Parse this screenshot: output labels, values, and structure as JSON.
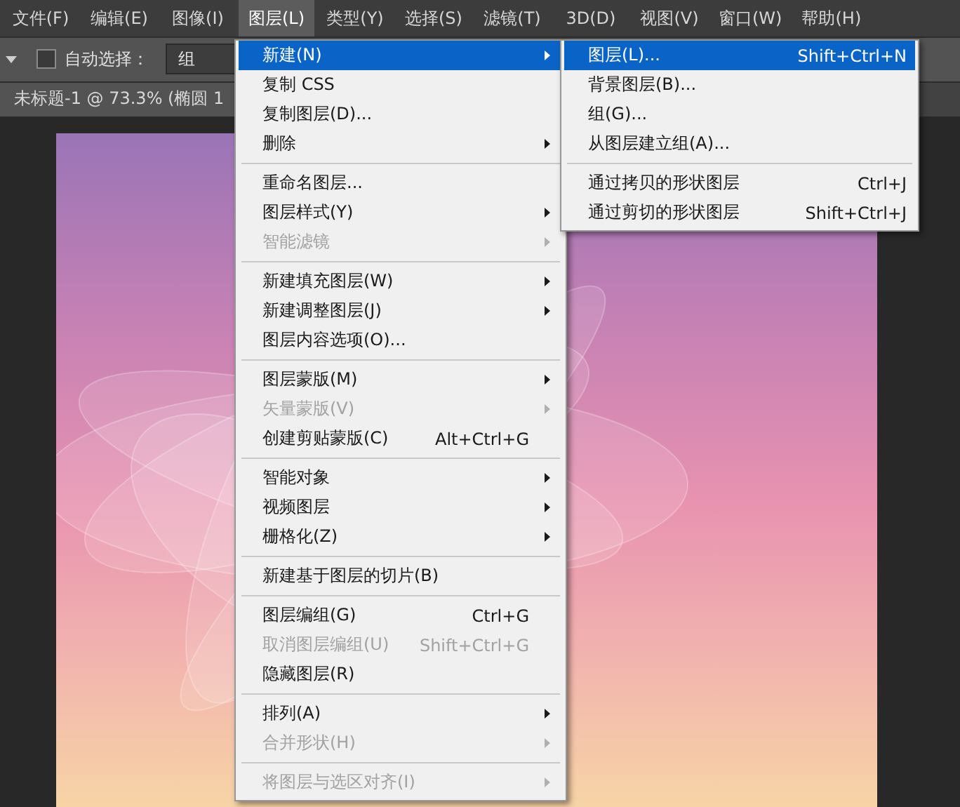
{
  "menubar": [
    {
      "label": "文件(F)",
      "selected": false
    },
    {
      "label": "编辑(E)",
      "selected": false
    },
    {
      "label": "图像(I)",
      "selected": false
    },
    {
      "label": "图层(L)",
      "selected": true
    },
    {
      "label": "类型(Y)",
      "selected": false
    },
    {
      "label": "选择(S)",
      "selected": false
    },
    {
      "label": "滤镜(T)",
      "selected": false
    },
    {
      "label": "3D(D)",
      "selected": false
    },
    {
      "label": "视图(V)",
      "selected": false
    },
    {
      "label": "窗口(W)",
      "selected": false
    },
    {
      "label": "帮助(H)",
      "selected": false
    }
  ],
  "toolbar": {
    "auto_select": {
      "label": "自动选择：",
      "checked": false
    },
    "dropdown": {
      "value": "组"
    }
  },
  "document_tab": {
    "title": "未标题-1 @ 73.3% (椭圆 1"
  },
  "menu": {
    "items": [
      {
        "kind": "item",
        "label": "新建(N)",
        "submenu": true,
        "disabled": false,
        "selected": true
      },
      {
        "kind": "item",
        "label": "复制 CSS",
        "submenu": false,
        "disabled": false,
        "selected": false
      },
      {
        "kind": "item",
        "label": "复制图层(D)...",
        "submenu": false,
        "disabled": false,
        "selected": false
      },
      {
        "kind": "item",
        "label": "删除",
        "submenu": true,
        "disabled": false,
        "selected": false
      },
      {
        "kind": "separator"
      },
      {
        "kind": "item",
        "label": "重命名图层...",
        "submenu": false,
        "disabled": false,
        "selected": false
      },
      {
        "kind": "item",
        "label": "图层样式(Y)",
        "submenu": true,
        "disabled": false,
        "selected": false
      },
      {
        "kind": "item",
        "label": "智能滤镜",
        "submenu": true,
        "disabled": true,
        "selected": false
      },
      {
        "kind": "separator"
      },
      {
        "kind": "item",
        "label": "新建填充图层(W)",
        "submenu": true,
        "disabled": false,
        "selected": false
      },
      {
        "kind": "item",
        "label": "新建调整图层(J)",
        "submenu": true,
        "disabled": false,
        "selected": false
      },
      {
        "kind": "item",
        "label": "图层内容选项(O)...",
        "submenu": false,
        "disabled": false,
        "selected": false
      },
      {
        "kind": "separator"
      },
      {
        "kind": "item",
        "label": "图层蒙版(M)",
        "submenu": true,
        "disabled": false,
        "selected": false
      },
      {
        "kind": "item",
        "label": "矢量蒙版(V)",
        "submenu": true,
        "disabled": true,
        "selected": false
      },
      {
        "kind": "item",
        "label": "创建剪贴蒙版(C)",
        "shortcut": "Alt+Ctrl+G",
        "submenu": false,
        "disabled": false,
        "selected": false
      },
      {
        "kind": "separator"
      },
      {
        "kind": "item",
        "label": "智能对象",
        "submenu": true,
        "disabled": false,
        "selected": false
      },
      {
        "kind": "item",
        "label": "视频图层",
        "submenu": true,
        "disabled": false,
        "selected": false
      },
      {
        "kind": "item",
        "label": "栅格化(Z)",
        "submenu": true,
        "disabled": false,
        "selected": false
      },
      {
        "kind": "separator"
      },
      {
        "kind": "item",
        "label": "新建基于图层的切片(B)",
        "submenu": false,
        "disabled": false,
        "selected": false
      },
      {
        "kind": "separator"
      },
      {
        "kind": "item",
        "label": "图层编组(G)",
        "shortcut": "Ctrl+G",
        "submenu": false,
        "disabled": false,
        "selected": false
      },
      {
        "kind": "item",
        "label": "取消图层编组(U)",
        "shortcut": "Shift+Ctrl+G",
        "submenu": false,
        "disabled": true,
        "selected": false
      },
      {
        "kind": "item",
        "label": "隐藏图层(R)",
        "submenu": false,
        "disabled": false,
        "selected": false
      },
      {
        "kind": "separator"
      },
      {
        "kind": "item",
        "label": "排列(A)",
        "submenu": true,
        "disabled": false,
        "selected": false
      },
      {
        "kind": "item",
        "label": "合并形状(H)",
        "submenu": true,
        "disabled": true,
        "selected": false
      },
      {
        "kind": "separator"
      },
      {
        "kind": "item",
        "label": "将图层与选区对齐(I)",
        "submenu": true,
        "disabled": true,
        "selected": false
      }
    ]
  },
  "submenu": {
    "items": [
      {
        "kind": "item",
        "label": "图层(L)...",
        "shortcut": "Shift+Ctrl+N",
        "disabled": false,
        "selected": true
      },
      {
        "kind": "item",
        "label": "背景图层(B)...",
        "disabled": false,
        "selected": false
      },
      {
        "kind": "item",
        "label": "组(G)...",
        "disabled": false,
        "selected": false
      },
      {
        "kind": "item",
        "label": "从图层建立组(A)...",
        "disabled": false,
        "selected": false
      },
      {
        "kind": "separator"
      },
      {
        "kind": "item",
        "label": "通过拷贝的形状图层",
        "shortcut": "Ctrl+J",
        "disabled": false,
        "selected": false
      },
      {
        "kind": "item",
        "label": "通过剪切的形状图层",
        "shortcut": "Shift+Ctrl+J",
        "disabled": false,
        "selected": false
      }
    ]
  }
}
